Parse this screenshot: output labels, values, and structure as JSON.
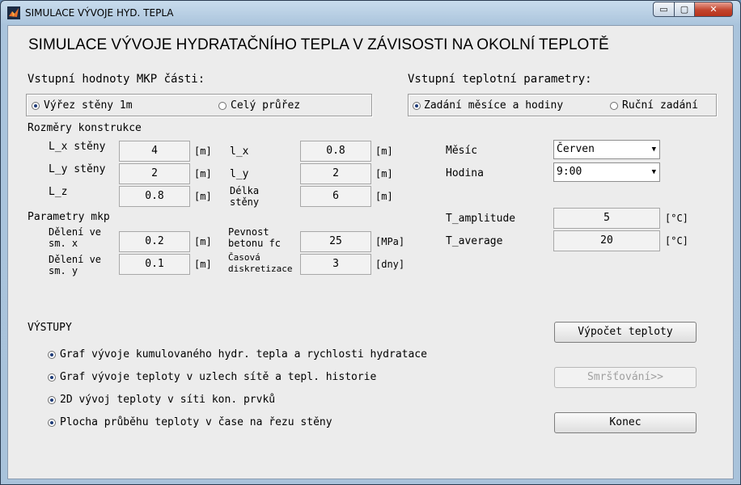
{
  "window": {
    "title": "SIMULACE VÝVOJE HYD. TEPLA",
    "min": "▭",
    "max": "▢",
    "close": "✕"
  },
  "heading": "SIMULACE VÝVOJE HYDRATAČNÍHO TEPLA V ZÁVISOSTI NA OKOLNÍ TEPLOTĚ",
  "mkp": {
    "title": "Vstupní hodnoty MKP části:",
    "radio_section": "Výřez stěny 1m",
    "radio_full": "Celý průřez",
    "dims_label": "Rozměry konstrukce",
    "lx_wall_label": "L_x stěny",
    "lx_wall": "4",
    "lx_wall_unit": "[m]",
    "ly_wall_label": "L_y stěny",
    "ly_wall": "2",
    "ly_wall_unit": "[m]",
    "lz_label": "L_z",
    "lz": "0.8",
    "lz_unit": "[m]",
    "lx_label": "l_x",
    "lx": "0.8",
    "lx_unit": "[m]",
    "ly_label": "l_y",
    "ly": "2",
    "ly_unit": "[m]",
    "wall_len_label_1": "Délka",
    "wall_len_label_2": "stěny",
    "wall_len": "6",
    "wall_len_unit": "[m]",
    "params_label": "Parametry mkp",
    "div_x_label_1": "Dělení ve",
    "div_x_label_2": "sm. x",
    "div_x": "0.2",
    "div_x_unit": "[m]",
    "div_y_label_1": "Dělení ve",
    "div_y_label_2": "sm. y",
    "div_y": "0.1",
    "div_y_unit": "[m]",
    "strength_label_1": "Pevnost",
    "strength_label_2": "betonu fc",
    "strength": "25",
    "strength_unit": "[MPa]",
    "time_label_1": "Časová",
    "time_label_2": "diskretizace",
    "time_disc": "3",
    "time_unit": "[dny]"
  },
  "temp": {
    "title": "Vstupní teplotní parametry:",
    "radio_month": "Zadání měsíce a hodiny",
    "radio_manual": "Ruční zadání",
    "month_label": "Měsíc",
    "month_value": "Červen",
    "hour_label": "Hodina",
    "hour_value": "9:00",
    "amp_label": "T_amplitude",
    "amp_value": "5",
    "amp_unit": "[°C]",
    "avg_label": "T_average",
    "avg_value": "20",
    "avg_unit": "[°C]"
  },
  "outputs": {
    "title": "VÝSTUPY",
    "opt1": "Graf vývoje kumulovaného hydr. tepla a rychlosti hydratace",
    "opt2": "Graf vývoje teploty v uzlech sítě a tepl. historie",
    "opt3": "2D vývoj teploty v síti kon. prvků",
    "opt4": "Plocha průběhu teploty v čase na řezu stěny"
  },
  "buttons": {
    "compute": "Výpočet teploty",
    "shrink": "Smršťování>>",
    "end": "Konec"
  },
  "colors": {
    "close_button": "#c2452e",
    "radio_dot": "#1d3b78",
    "client_bg": "#ececec"
  }
}
